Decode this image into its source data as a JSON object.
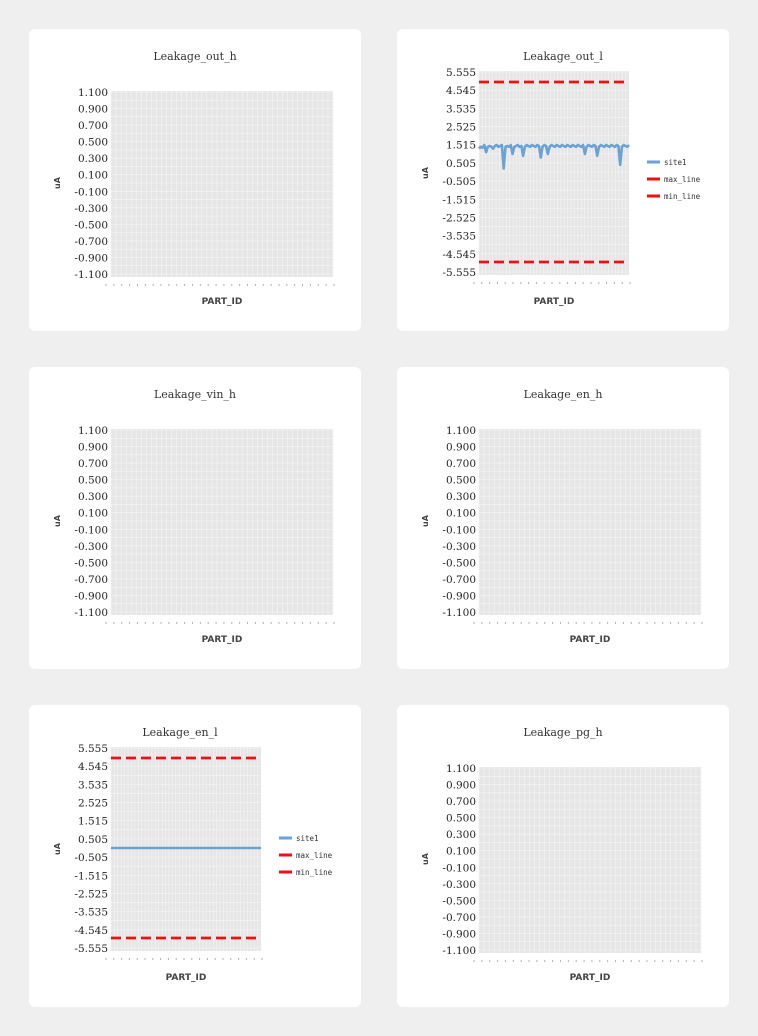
{
  "colors": {
    "plot_bg": "#e6e6e6",
    "grid": "#f5f5f5",
    "site1": "#6aa2d6",
    "max_line": "#ee1111",
    "min_line": "#ee1111"
  },
  "charts": [
    {
      "title": "Leakage_out_h",
      "xlabel": "PART_ID",
      "ylabel": "uA",
      "yticks": [
        "1.100",
        "0.900",
        "0.700",
        "0.500",
        "0.300",
        "0.100",
        "-0.100",
        "-0.300",
        "-0.500",
        "-0.700",
        "-0.900",
        "-1.100"
      ]
    },
    {
      "title": "Leakage_out_l",
      "xlabel": "PART_ID",
      "ylabel": "uA",
      "yticks": [
        "5.555",
        "4.545",
        "3.535",
        "2.525",
        "1.515",
        "0.505",
        "-0.505",
        "-1.515",
        "-2.525",
        "-3.535",
        "-4.545",
        "-5.555"
      ],
      "legend": [
        "site1",
        "max_line",
        "min_line"
      ]
    },
    {
      "title": "Leakage_vin_h",
      "xlabel": "PART_ID",
      "ylabel": "uA",
      "yticks": [
        "1.100",
        "0.900",
        "0.700",
        "0.500",
        "0.300",
        "0.100",
        "-0.100",
        "-0.300",
        "-0.500",
        "-0.700",
        "-0.900",
        "-1.100"
      ]
    },
    {
      "title": "Leakage_en_h",
      "xlabel": "PART_ID",
      "ylabel": "uA",
      "yticks": [
        "1.100",
        "0.900",
        "0.700",
        "0.500",
        "0.300",
        "0.100",
        "-0.100",
        "-0.300",
        "-0.500",
        "-0.700",
        "-0.900",
        "-1.100"
      ]
    },
    {
      "title": "Leakage_en_l",
      "xlabel": "PART_ID",
      "ylabel": "uA",
      "yticks": [
        "5.555",
        "4.545",
        "3.535",
        "2.525",
        "1.515",
        "0.505",
        "-0.505",
        "-1.515",
        "-2.525",
        "-3.535",
        "-4.545",
        "-5.555"
      ],
      "legend": [
        "site1",
        "max_line",
        "min_line"
      ]
    },
    {
      "title": "Leakage_pg_h",
      "xlabel": "PART_ID",
      "ylabel": "uA",
      "yticks": [
        "1.100",
        "0.900",
        "0.700",
        "0.500",
        "0.300",
        "0.100",
        "-0.100",
        "-0.300",
        "-0.500",
        "-0.700",
        "-0.900",
        "-1.100"
      ]
    }
  ],
  "chart_data": [
    {
      "type": "line",
      "title": "Leakage_out_h",
      "xlabel": "PART_ID",
      "ylabel": "uA",
      "ylim": [
        -1.1,
        1.1
      ],
      "grid": true,
      "series": []
    },
    {
      "type": "line",
      "title": "Leakage_out_l",
      "xlabel": "PART_ID",
      "ylabel": "uA",
      "ylim": [
        -5.555,
        5.555
      ],
      "grid": true,
      "legend_position": "right",
      "series": [
        {
          "name": "site1",
          "values": [
            1.3,
            1.4,
            1.35,
            1.5,
            1.1,
            1.4,
            1.45,
            1.4,
            1.3,
            1.45,
            1.5,
            1.4,
            1.45,
            1.5,
            0.2,
            1.4,
            1.45,
            1.4,
            1.5,
            1.0,
            1.4,
            1.45,
            1.5,
            1.4,
            1.45,
            0.9,
            1.4,
            1.5,
            1.45,
            1.4,
            1.5,
            1.45,
            1.4,
            1.5,
            1.45,
            0.8,
            1.4,
            1.5,
            1.45,
            1.0,
            1.4,
            1.5,
            1.45,
            1.4,
            1.5,
            1.45,
            1.4,
            1.5,
            1.45,
            1.4,
            1.5,
            1.45,
            1.4,
            1.5,
            1.45,
            1.4,
            1.5,
            1.45,
            1.4,
            1.5,
            1.0,
            1.4,
            1.5,
            1.45,
            1.4,
            1.5,
            1.45,
            0.9,
            1.4,
            1.5,
            1.45,
            1.4,
            1.5,
            1.45,
            1.4,
            1.5,
            1.45,
            1.4,
            1.5,
            1.45,
            0.4,
            1.4,
            1.5,
            1.45,
            1.4,
            1.5
          ]
        },
        {
          "name": "max_line",
          "values": [
            5.0,
            5.0
          ]
        },
        {
          "name": "min_line",
          "values": [
            -5.0,
            -5.0
          ]
        }
      ]
    },
    {
      "type": "line",
      "title": "Leakage_vin_h",
      "xlabel": "PART_ID",
      "ylabel": "uA",
      "ylim": [
        -1.1,
        1.1
      ],
      "grid": true,
      "series": []
    },
    {
      "type": "line",
      "title": "Leakage_en_h",
      "xlabel": "PART_ID",
      "ylabel": "uA",
      "ylim": [
        -1.1,
        1.1
      ],
      "grid": true,
      "series": []
    },
    {
      "type": "line",
      "title": "Leakage_en_l",
      "xlabel": "PART_ID",
      "ylabel": "uA",
      "ylim": [
        -5.555,
        5.555
      ],
      "grid": true,
      "legend_position": "right",
      "series": [
        {
          "name": "site1",
          "values": [
            0.0,
            0.0
          ]
        },
        {
          "name": "max_line",
          "values": [
            5.0,
            5.0
          ]
        },
        {
          "name": "min_line",
          "values": [
            -5.0,
            -5.0
          ]
        }
      ]
    },
    {
      "type": "line",
      "title": "Leakage_pg_h",
      "xlabel": "PART_ID",
      "ylabel": "uA",
      "ylim": [
        -1.1,
        1.1
      ],
      "grid": true,
      "series": []
    }
  ]
}
